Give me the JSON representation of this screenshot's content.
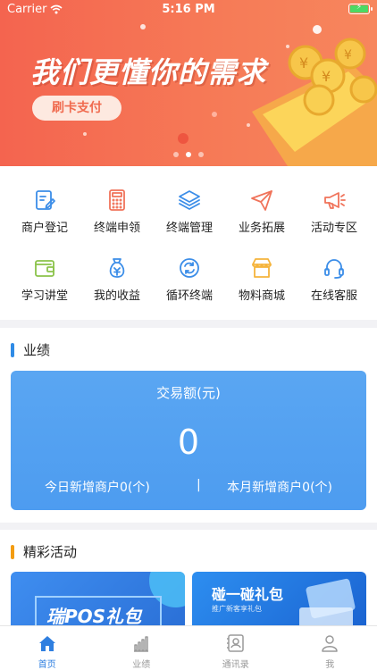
{
  "status_bar": {
    "carrier": "Carrier",
    "time": "5:16 PM"
  },
  "banner": {
    "title": "我们更懂你的需求",
    "button_label": "刷卡支付",
    "slide_count": 3,
    "active_slide": 1
  },
  "menu": [
    {
      "label": "商户登记",
      "icon": "edit-doc-icon",
      "color": "#3b8de8"
    },
    {
      "label": "终端申领",
      "icon": "calculator-icon",
      "color": "#f0735a"
    },
    {
      "label": "终端管理",
      "icon": "layers-icon",
      "color": "#3b8de8"
    },
    {
      "label": "业务拓展",
      "icon": "paper-plane-icon",
      "color": "#f0735a"
    },
    {
      "label": "活动专区",
      "icon": "megaphone-icon",
      "color": "#f0735a"
    },
    {
      "label": "学习讲堂",
      "icon": "wallet-icon",
      "color": "#8bc34a"
    },
    {
      "label": "我的收益",
      "icon": "money-bag-icon",
      "color": "#3b8de8"
    },
    {
      "label": "循环终端",
      "icon": "refresh-icon",
      "color": "#3b8de8"
    },
    {
      "label": "物料商城",
      "icon": "store-icon",
      "color": "#f5b43c"
    },
    {
      "label": "在线客服",
      "icon": "headset-icon",
      "color": "#3b8de8"
    }
  ],
  "performance": {
    "section_title": "业绩",
    "accent": "#2f8be6",
    "card": {
      "label": "交易额(元)",
      "value": "0",
      "today_new": "今日新增商户0(个)",
      "separator": "|",
      "month_new": "本月新增商户0(个)"
    }
  },
  "activities": {
    "section_title": "精彩活动",
    "accent": "#f39c12",
    "cards": [
      {
        "text": "瑞POS礼包"
      },
      {
        "text": "碰一碰礼包",
        "subtitle": "推广新客享礼包"
      }
    ]
  },
  "tabbar": [
    {
      "label": "首页",
      "icon": "home-icon",
      "active": true
    },
    {
      "label": "业绩",
      "icon": "bar-chart-icon",
      "active": false
    },
    {
      "label": "通讯录",
      "icon": "contacts-icon",
      "active": false
    },
    {
      "label": "我",
      "icon": "profile-icon",
      "active": false
    }
  ]
}
